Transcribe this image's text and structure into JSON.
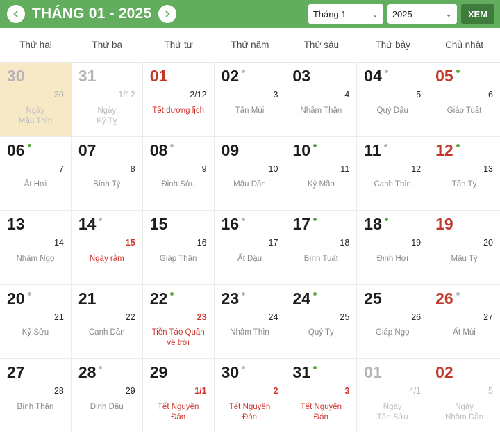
{
  "header": {
    "title": "THÁNG 01 - 2025",
    "prev_icon": "chevron-left-icon",
    "next_icon": "chevron-right-icon",
    "month_select": "Tháng 1",
    "year_select": "2025",
    "view_button": "XEM",
    "chevron": "⌄",
    "bg_color": "#62ad5e",
    "button_color": "#3f7c3c"
  },
  "weekdays": [
    "Thứ hai",
    "Thứ ba",
    "Thứ tư",
    "Thứ năm",
    "Thứ sáu",
    "Thứ bảy",
    "Chủ nhật"
  ],
  "colors": {
    "sunday": "#c0392b",
    "event": "#d0342c",
    "outside": "#b5b5b5",
    "today_bg": "#f7e8c6",
    "dot_green": "#5aa83f",
    "dot_gray": "#b8b8b8"
  },
  "days": [
    {
      "solar": "30",
      "lunar": "30",
      "note": "Ngày\nMậu Thìn",
      "style": "out",
      "dot": "none",
      "today": true,
      "lunar_style": "out",
      "note_style": "out"
    },
    {
      "solar": "31",
      "lunar": "1/12",
      "note": "Ngày\nKỷ Tỵ",
      "style": "out",
      "dot": "none",
      "today": false,
      "lunar_style": "out",
      "note_style": "out"
    },
    {
      "solar": "01",
      "lunar": "2/12",
      "note": "Tết dương lịch",
      "style": "sun",
      "dot": "none",
      "today": false,
      "lunar_style": "",
      "note_style": "red"
    },
    {
      "solar": "02",
      "lunar": "3",
      "note": "Tân Mùi",
      "style": "",
      "dot": "gray",
      "today": false,
      "lunar_style": "",
      "note_style": ""
    },
    {
      "solar": "03",
      "lunar": "4",
      "note": "Nhâm Thân",
      "style": "",
      "dot": "none",
      "today": false,
      "lunar_style": "",
      "note_style": ""
    },
    {
      "solar": "04",
      "lunar": "5",
      "note": "Quý Dậu",
      "style": "",
      "dot": "gray",
      "today": false,
      "lunar_style": "",
      "note_style": ""
    },
    {
      "solar": "05",
      "lunar": "6",
      "note": "Giáp Tuất",
      "style": "sun",
      "dot": "green",
      "today": false,
      "lunar_style": "",
      "note_style": ""
    },
    {
      "solar": "06",
      "lunar": "7",
      "note": "Ất Hợi",
      "style": "",
      "dot": "green",
      "today": false,
      "lunar_style": "",
      "note_style": ""
    },
    {
      "solar": "07",
      "lunar": "8",
      "note": "Bính Tý",
      "style": "",
      "dot": "none",
      "today": false,
      "lunar_style": "",
      "note_style": ""
    },
    {
      "solar": "08",
      "lunar": "9",
      "note": "Đinh Sửu",
      "style": "",
      "dot": "gray",
      "today": false,
      "lunar_style": "",
      "note_style": ""
    },
    {
      "solar": "09",
      "lunar": "10",
      "note": "Mậu Dần",
      "style": "",
      "dot": "none",
      "today": false,
      "lunar_style": "",
      "note_style": ""
    },
    {
      "solar": "10",
      "lunar": "11",
      "note": "Kỷ Mão",
      "style": "",
      "dot": "green",
      "today": false,
      "lunar_style": "",
      "note_style": ""
    },
    {
      "solar": "11",
      "lunar": "12",
      "note": "Canh Thìn",
      "style": "",
      "dot": "gray",
      "today": false,
      "lunar_style": "",
      "note_style": ""
    },
    {
      "solar": "12",
      "lunar": "13",
      "note": "Tân Tỵ",
      "style": "sun",
      "dot": "green",
      "today": false,
      "lunar_style": "",
      "note_style": ""
    },
    {
      "solar": "13",
      "lunar": "14",
      "note": "Nhâm Ngọ",
      "style": "",
      "dot": "none",
      "today": false,
      "lunar_style": "",
      "note_style": ""
    },
    {
      "solar": "14",
      "lunar": "15",
      "note": "Ngày rằm",
      "style": "",
      "dot": "gray",
      "today": false,
      "lunar_style": "red",
      "note_style": "red"
    },
    {
      "solar": "15",
      "lunar": "16",
      "note": "Giáp Thân",
      "style": "",
      "dot": "none",
      "today": false,
      "lunar_style": "",
      "note_style": ""
    },
    {
      "solar": "16",
      "lunar": "17",
      "note": "Ất Dậu",
      "style": "",
      "dot": "gray",
      "today": false,
      "lunar_style": "",
      "note_style": ""
    },
    {
      "solar": "17",
      "lunar": "18",
      "note": "Bính Tuất",
      "style": "",
      "dot": "green",
      "today": false,
      "lunar_style": "",
      "note_style": ""
    },
    {
      "solar": "18",
      "lunar": "19",
      "note": "Đinh Hợi",
      "style": "",
      "dot": "green",
      "today": false,
      "lunar_style": "",
      "note_style": ""
    },
    {
      "solar": "19",
      "lunar": "20",
      "note": "Mậu Tý",
      "style": "sun",
      "dot": "none",
      "today": false,
      "lunar_style": "",
      "note_style": ""
    },
    {
      "solar": "20",
      "lunar": "21",
      "note": "Kỷ Sửu",
      "style": "",
      "dot": "gray",
      "today": false,
      "lunar_style": "",
      "note_style": ""
    },
    {
      "solar": "21",
      "lunar": "22",
      "note": "Canh Dần",
      "style": "",
      "dot": "none",
      "today": false,
      "lunar_style": "",
      "note_style": ""
    },
    {
      "solar": "22",
      "lunar": "23",
      "note": "Tiễn Táo Quân\nvề trời",
      "style": "",
      "dot": "green",
      "today": false,
      "lunar_style": "red",
      "note_style": "red"
    },
    {
      "solar": "23",
      "lunar": "24",
      "note": "Nhâm Thìn",
      "style": "",
      "dot": "gray",
      "today": false,
      "lunar_style": "",
      "note_style": ""
    },
    {
      "solar": "24",
      "lunar": "25",
      "note": "Quý Tỵ",
      "style": "",
      "dot": "green",
      "today": false,
      "lunar_style": "",
      "note_style": ""
    },
    {
      "solar": "25",
      "lunar": "26",
      "note": "Giáp Ngọ",
      "style": "",
      "dot": "none",
      "today": false,
      "lunar_style": "",
      "note_style": ""
    },
    {
      "solar": "26",
      "lunar": "27",
      "note": "Ất Mùi",
      "style": "sun",
      "dot": "gray",
      "today": false,
      "lunar_style": "",
      "note_style": ""
    },
    {
      "solar": "27",
      "lunar": "28",
      "note": "Bính Thân",
      "style": "",
      "dot": "none",
      "today": false,
      "lunar_style": "",
      "note_style": ""
    },
    {
      "solar": "28",
      "lunar": "29",
      "note": "Đinh Dậu",
      "style": "",
      "dot": "gray",
      "today": false,
      "lunar_style": "",
      "note_style": ""
    },
    {
      "solar": "29",
      "lunar": "1/1",
      "note": "Tết Nguyên\nĐán",
      "style": "",
      "dot": "none",
      "today": false,
      "lunar_style": "red",
      "note_style": "red"
    },
    {
      "solar": "30",
      "lunar": "2",
      "note": "Tết Nguyên\nĐán",
      "style": "",
      "dot": "gray",
      "today": false,
      "lunar_style": "red",
      "note_style": "red"
    },
    {
      "solar": "31",
      "lunar": "3",
      "note": "Tết Nguyên\nĐán",
      "style": "",
      "dot": "green",
      "today": false,
      "lunar_style": "red",
      "note_style": "red"
    },
    {
      "solar": "01",
      "lunar": "4/1",
      "note": "Ngày\nTân Sửu",
      "style": "out",
      "dot": "none",
      "today": false,
      "lunar_style": "out",
      "note_style": "out"
    },
    {
      "solar": "02",
      "lunar": "5",
      "note": "Ngày\nNhâm Dần",
      "style": "sun",
      "dot": "none",
      "today": false,
      "lunar_style": "out",
      "note_style": "out"
    }
  ]
}
